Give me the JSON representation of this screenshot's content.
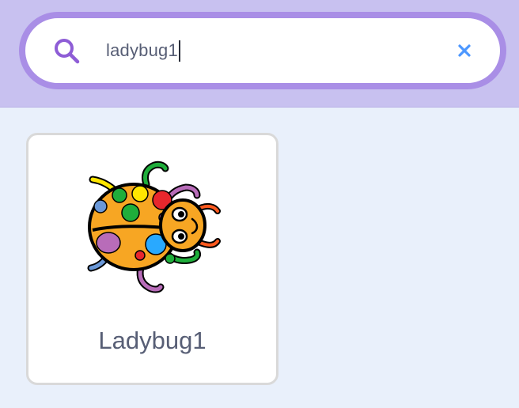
{
  "search": {
    "value": "ladybug1",
    "search_icon": "search-icon",
    "clear_icon": "close-icon",
    "accent_color": "#a98ee6",
    "clear_color": "#4c97ff"
  },
  "library": {
    "items": [
      {
        "name": "Ladybug1",
        "thumbnail": "ladybug-sprite"
      }
    ]
  }
}
